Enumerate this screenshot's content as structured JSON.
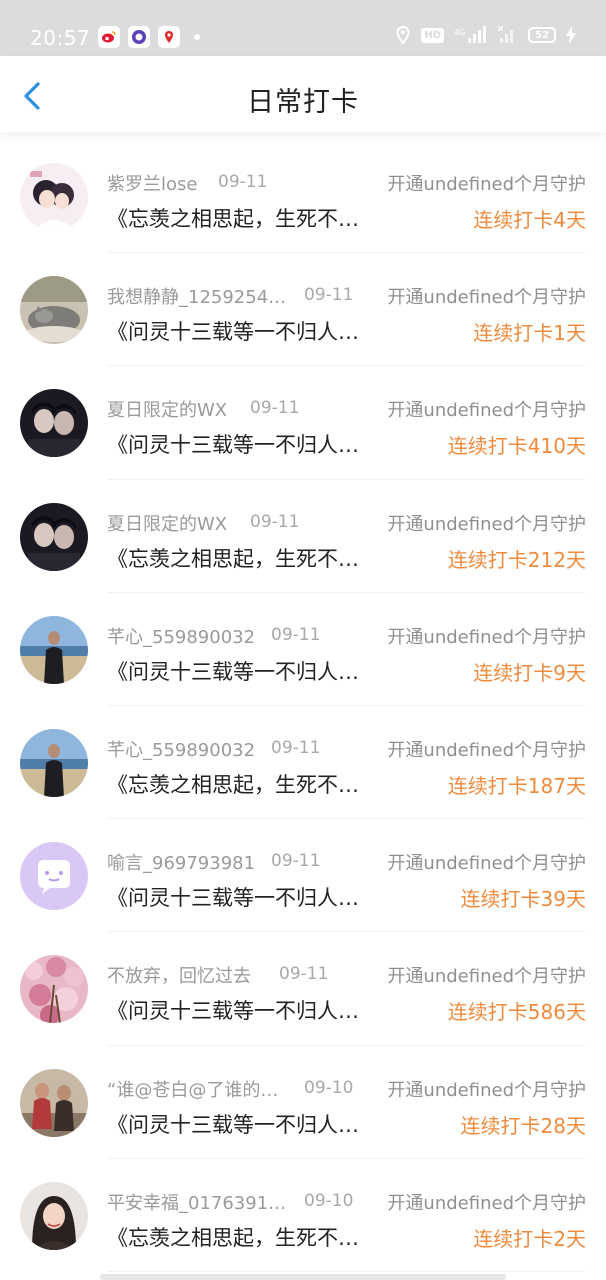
{
  "status_bar": {
    "time": "20:57",
    "network": "4G",
    "battery": "52"
  },
  "header": {
    "title": "日常打卡"
  },
  "items": [
    {
      "username": "紫罗兰lose",
      "date": "09-11",
      "guard": "开通undefined个月守护",
      "content": "《忘羡之相思起，生死不…",
      "streak": "连续打卡4天",
      "avatar_theme": "anime"
    },
    {
      "username": "我想静静_1259254…",
      "date": "09-11",
      "guard": "开通undefined个月守护",
      "content": "《问灵十三载等一不归人…",
      "streak": "连续打卡1天",
      "avatar_theme": "cat"
    },
    {
      "username": "夏日限定的WX",
      "date": "09-11",
      "guard": "开通undefined个月守护",
      "content": "《问灵十三载等一不归人…",
      "streak": "连续打卡410天",
      "avatar_theme": "dark"
    },
    {
      "username": "夏日限定的WX",
      "date": "09-11",
      "guard": "开通undefined个月守护",
      "content": "《忘羡之相思起，生死不…",
      "streak": "连续打卡212天",
      "avatar_theme": "dark"
    },
    {
      "username": "芊心_559890032",
      "date": "09-11",
      "guard": "开通undefined个月守护",
      "content": "《问灵十三载等一不归人…",
      "streak": "连续打卡9天",
      "avatar_theme": "beach"
    },
    {
      "username": "芊心_559890032",
      "date": "09-11",
      "guard": "开通undefined个月守护",
      "content": "《忘羡之相思起，生死不…",
      "streak": "连续打卡187天",
      "avatar_theme": "beach"
    },
    {
      "username": "喻言_969793981",
      "date": "09-11",
      "guard": "开通undefined个月守护",
      "content": "《问灵十三载等一不归人…",
      "streak": "连续打卡39天",
      "avatar_theme": "purple"
    },
    {
      "username": "不放弃，回忆过去",
      "date": "09-11",
      "guard": "开通undefined个月守护",
      "content": "《问灵十三载等一不归人…",
      "streak": "连续打卡586天",
      "avatar_theme": "flowers"
    },
    {
      "username": "“谁@苍白@了谁的…",
      "date": "09-10",
      "guard": "开通undefined个月守护",
      "content": "《问灵十三载等一不归人…",
      "streak": "连续打卡28天",
      "avatar_theme": "people"
    },
    {
      "username": "平安幸福_0176391…",
      "date": "09-10",
      "guard": "开通undefined个月守护",
      "content": "《忘羡之相思起，生死不…",
      "streak": "连续打卡2天",
      "avatar_theme": "portrait"
    }
  ],
  "colors": {
    "accent_blue": "#2b8fe6",
    "streak_orange": "#f08a3c",
    "status_bar_bg": "#dcdcdc"
  }
}
